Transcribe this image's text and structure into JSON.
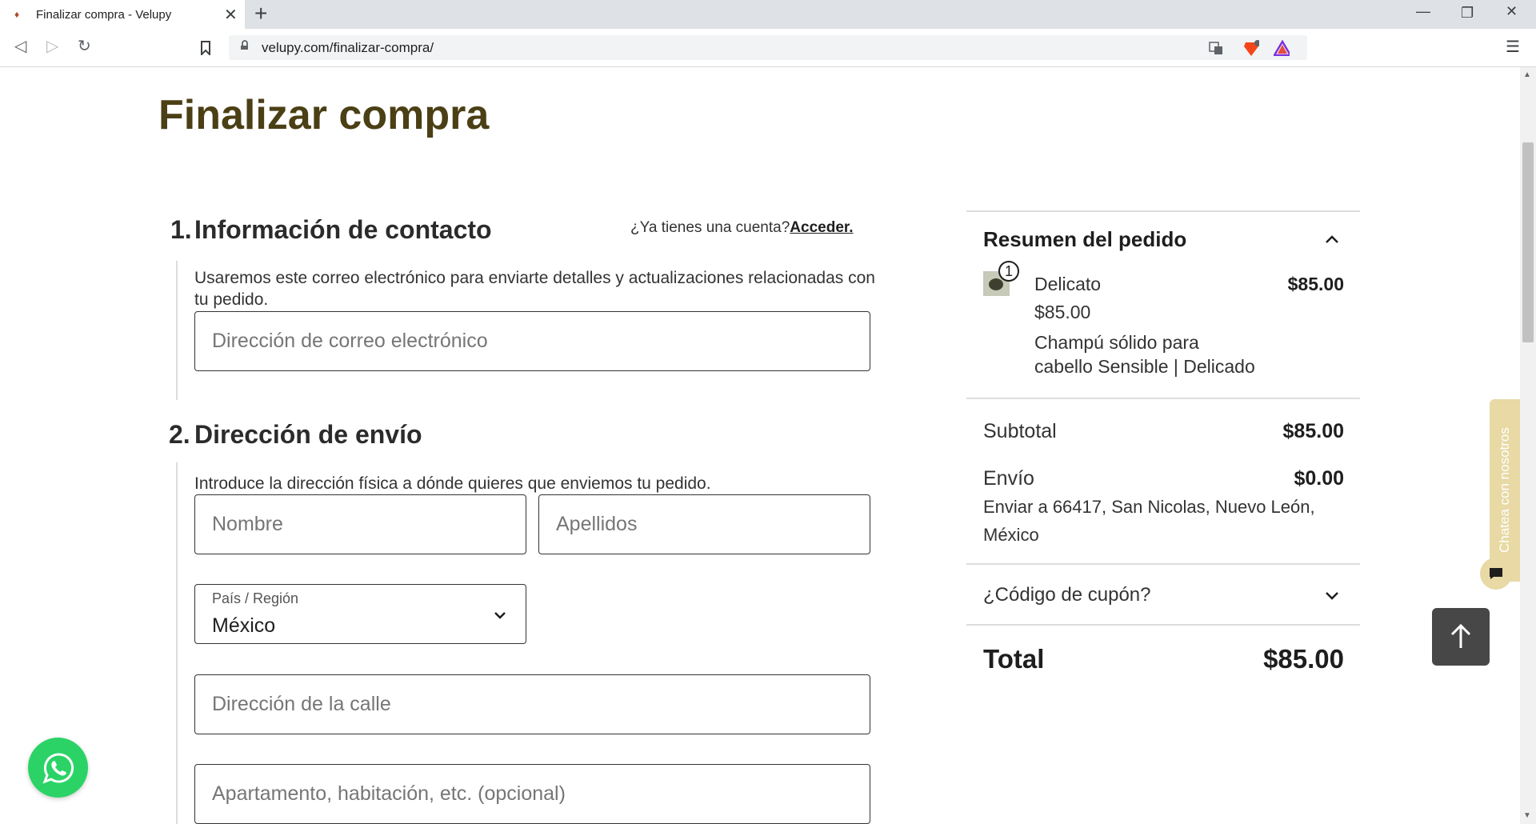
{
  "browser": {
    "tab_title": "Finalizar compra - Velupy",
    "url": "velupy.com/finalizar-compra/"
  },
  "page": {
    "title": "Finalizar compra"
  },
  "contact": {
    "number": "1.",
    "title": "Información de contacto",
    "login_question": "¿Ya tienes una cuenta?",
    "login_link": "Acceder.",
    "description": "Usaremos este correo electrónico para enviarte detalles y actualizaciones relacionadas con tu pedido.",
    "email_placeholder": "Dirección de correo electrónico"
  },
  "shipping": {
    "number": "2.",
    "title": "Dirección de envío",
    "description": "Introduce la dirección física a dónde quieres que enviemos tu pedido.",
    "first_name_placeholder": "Nombre",
    "last_name_placeholder": "Apellidos",
    "country_label": "País / Región",
    "country_value": "México",
    "street_placeholder": "Dirección de la calle",
    "apartment_placeholder": "Apartamento, habitación, etc. (opcional)"
  },
  "summary": {
    "title": "Resumen del pedido",
    "item": {
      "quantity": "1",
      "name": "Delicato",
      "unit_price": "$85.00",
      "total": "$85.00",
      "description_line1": "Champú sólido para",
      "description_line2": "cabello Sensible | Delicado"
    },
    "subtotal_label": "Subtotal",
    "subtotal_value": "$85.00",
    "shipping_label": "Envío",
    "shipping_value": "$0.00",
    "shipping_dest_line1": "Enviar a 66417, San Nicolas, Nuevo León,",
    "shipping_dest_line2": "México",
    "coupon_label": "¿Código de cupón?",
    "total_label": "Total",
    "total_value": "$85.00"
  },
  "floating": {
    "chat_label": "Chatea con nosotros"
  },
  "colors": {
    "title_brown": "#4b3f15",
    "chat_tan": "#e8d9a5",
    "whatsapp_green": "#2bd366"
  }
}
